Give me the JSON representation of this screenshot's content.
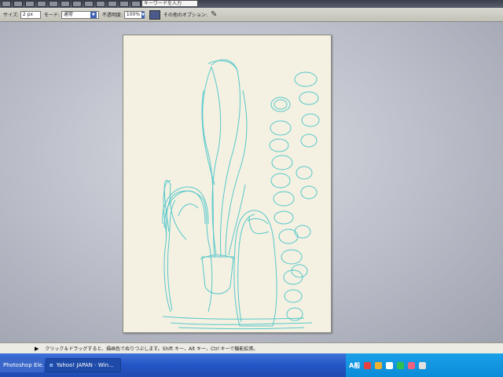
{
  "toolbar": {
    "keyword_placeholder": "キーワードを入力"
  },
  "options": {
    "size_label": "サイズ:",
    "size_value": "2 px",
    "mode_label": "モード:",
    "mode_value": "通常",
    "opacity_label": "不透明度:",
    "opacity_value": "100%",
    "other_options_label": "その他のオプション:"
  },
  "status": {
    "text": "クリック＆ドラッグすると、描画色でぬりつぶします。Shift キー、Alt キー、Ctrl キーで機能拡張。"
  },
  "taskbar": {
    "photoshop_task": "Photoshop Ele...",
    "yahoo_task": "Yahoo! JAPAN - Win...",
    "ime_label": "A般",
    "tray_icon_colors": [
      "#e84040",
      "#f0b030",
      "#ffffff",
      "#30c050",
      "#f06080",
      "#e0e0e0"
    ]
  },
  "canvas": {
    "paper_color": "#f4f1e2",
    "sketch_color": "#3cc0c8"
  }
}
